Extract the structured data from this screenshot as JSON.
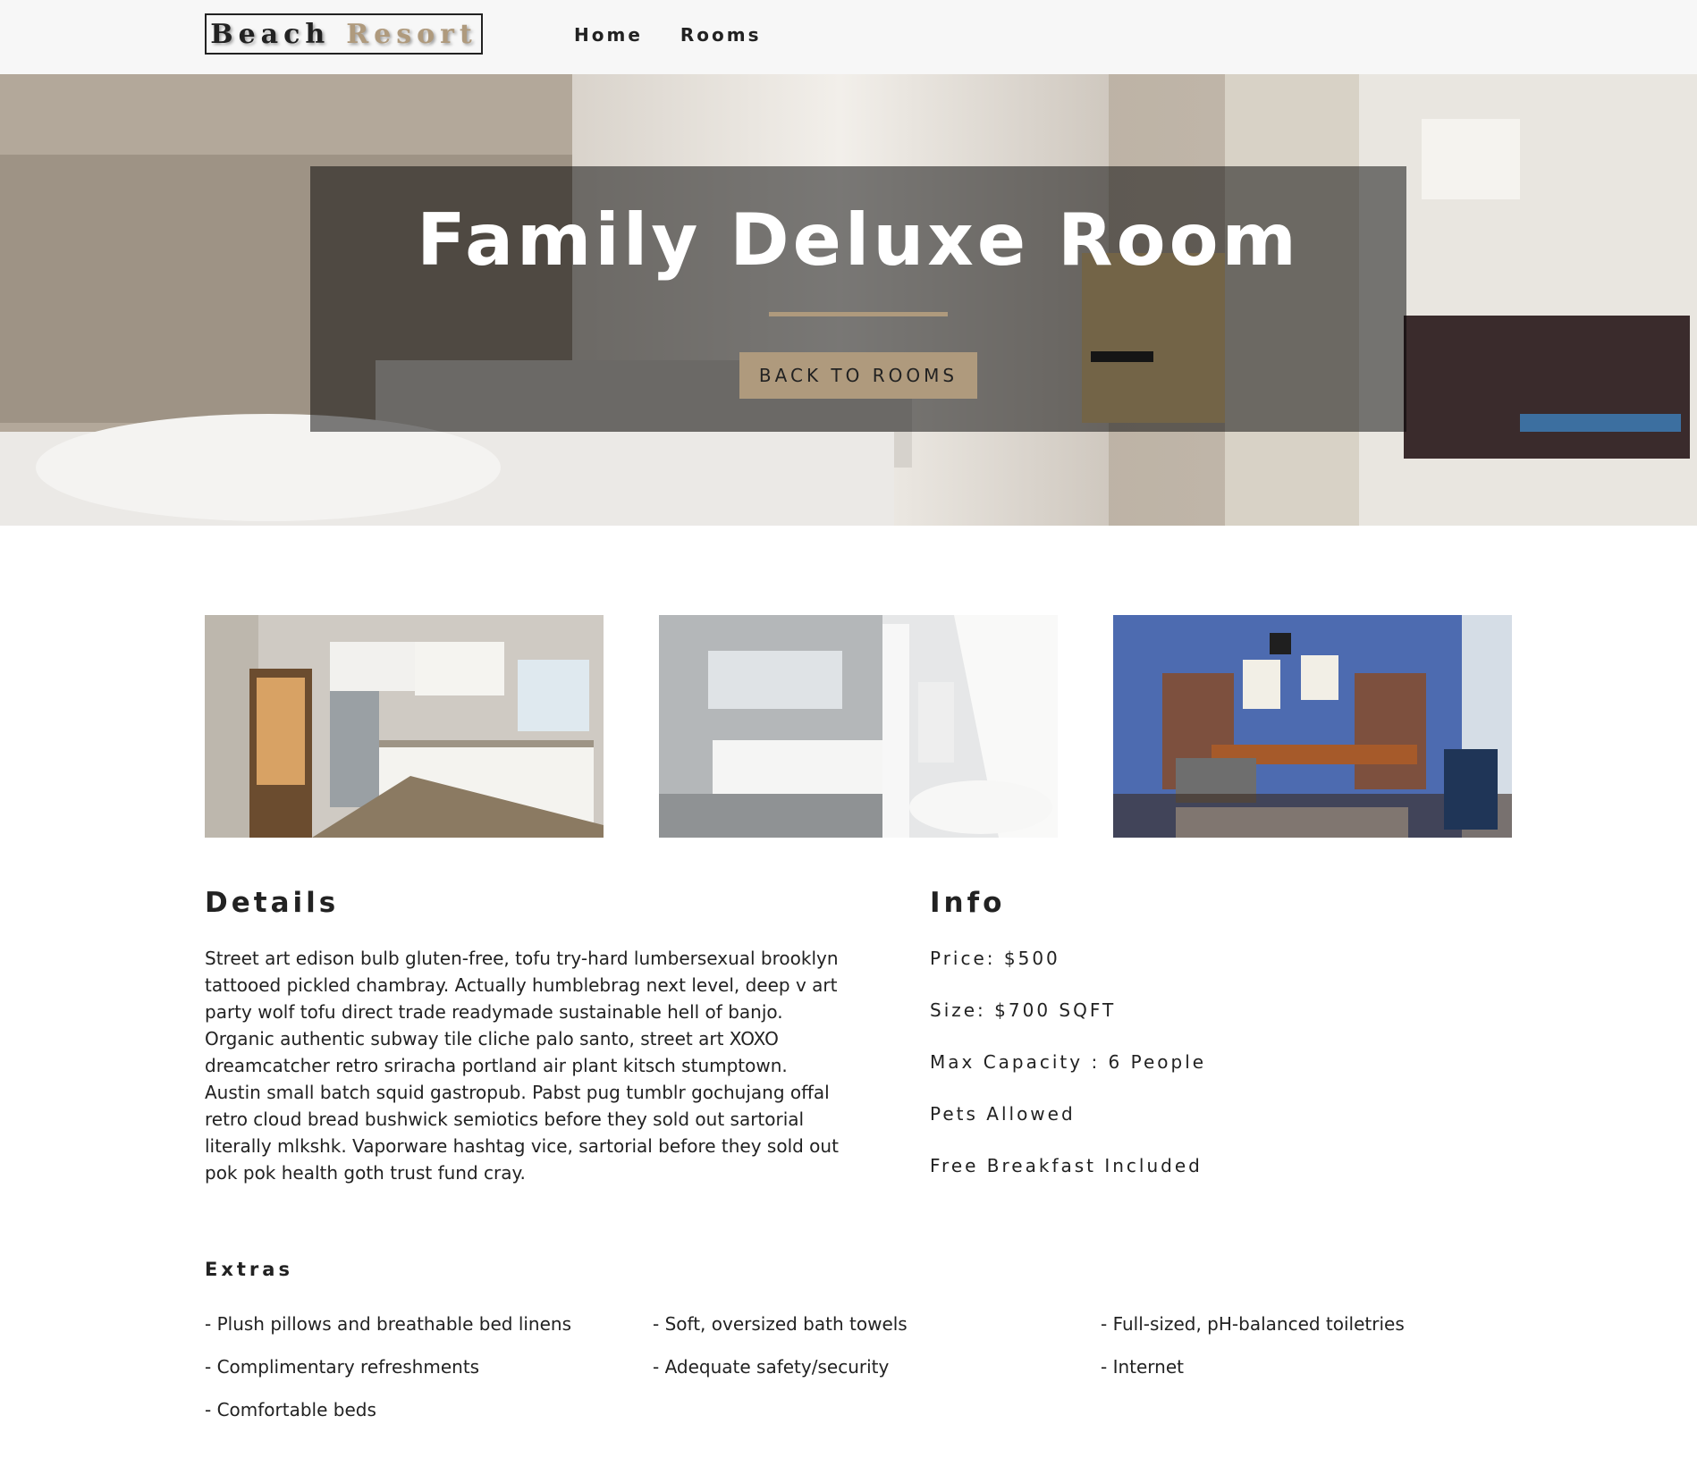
{
  "navbar": {
    "logo_word1": "Beach",
    "logo_word2": "Resort",
    "links": [
      "Home",
      "Rooms"
    ]
  },
  "hero": {
    "title": "Family Deluxe Room",
    "button_label": "BACK TO ROOMS",
    "accent_color": "#af9a7d"
  },
  "gallery": {
    "images": [
      "kitchen photo",
      "bathroom photo",
      "living room office photo"
    ]
  },
  "details": {
    "heading": "Details",
    "text": "Street art edison bulb gluten-free, tofu try-hard lumbersexual brooklyn tattooed pickled chambray. Actually humblebrag next level, deep v art party wolf tofu direct trade readymade sustainable hell of banjo. Organic authentic subway tile cliche palo santo, street art XOXO dreamcatcher retro sriracha portland air plant kitsch stumptown. Austin small batch squid gastropub. Pabst pug tumblr gochujang offal retro cloud bread bushwick semiotics before they sold out sartorial literally mlkshk. Vaporware hashtag vice, sartorial before they sold out pok pok health goth trust fund cray."
  },
  "info": {
    "heading": "Info",
    "items": [
      "Price: $500",
      "Size: $700 SQFT",
      "Max Capacity : 6 People",
      "Pets Allowed",
      "Free Breakfast Included"
    ]
  },
  "extras": {
    "heading": "Extras",
    "items": [
      "- Plush pillows and breathable bed linens",
      "- Soft, oversized bath towels",
      "- Full-sized, pH-balanced toiletries",
      "- Complimentary refreshments",
      "- Adequate safety/security",
      "- Internet",
      "- Comfortable beds"
    ]
  }
}
